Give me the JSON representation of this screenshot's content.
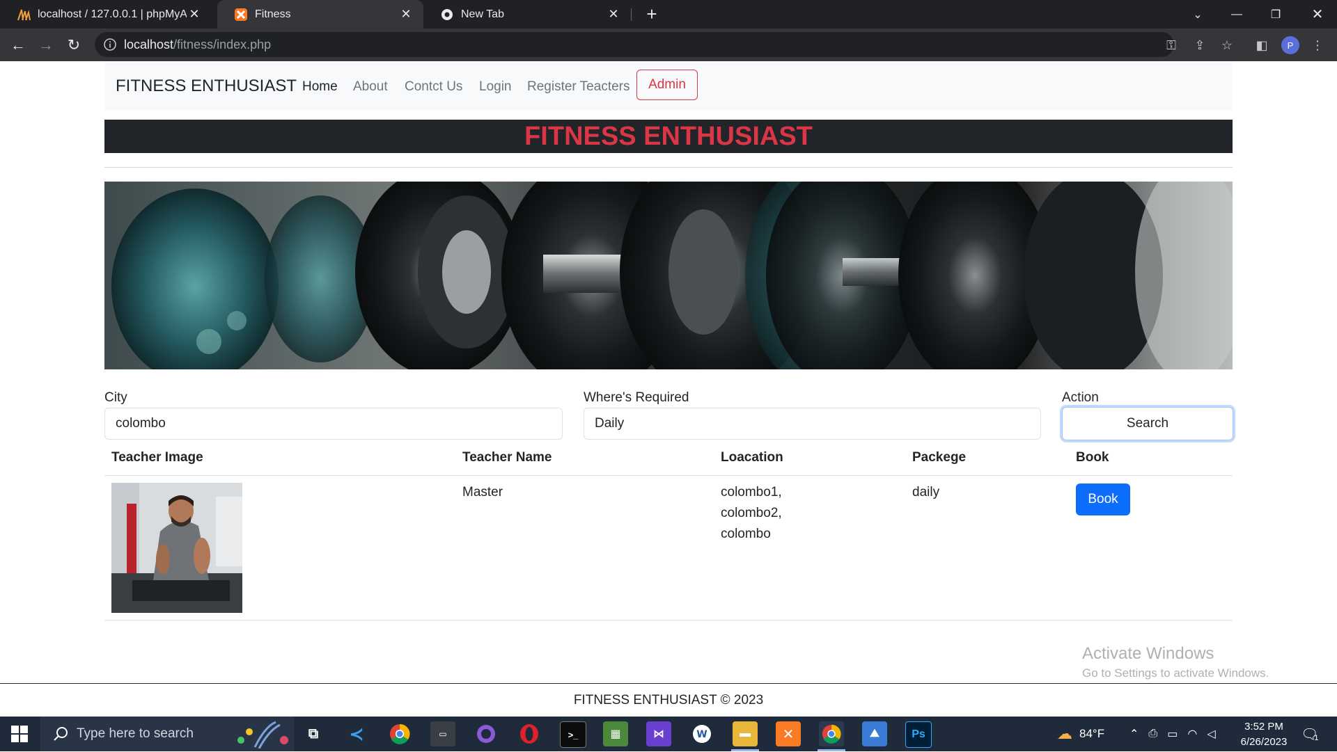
{
  "browser": {
    "tabs": [
      {
        "title": "localhost / 127.0.0.1 | phpMyAdmin",
        "icon": "phpmyadmin-icon",
        "active": false
      },
      {
        "title": "Fitness",
        "icon": "xampp-icon",
        "active": true
      },
      {
        "title": "New Tab",
        "icon": "chrome-icon",
        "active": false
      }
    ],
    "url_host": "localhost",
    "url_path": "/fitness/index.php",
    "profile_initial": "P"
  },
  "navbar": {
    "brand": "FITNESS ENTHUSIAST",
    "links": [
      "Home",
      "About",
      "Contct Us",
      "Login",
      "Register Teacters"
    ],
    "admin": "Admin"
  },
  "banner": {
    "title": "FITNESS ENTHUSIAST"
  },
  "search": {
    "city_label": "City",
    "city_value": "colombo",
    "required_label": "Where's Required",
    "required_value": "Daily",
    "action_label": "Action",
    "search_button": "Search"
  },
  "table": {
    "headers": [
      "Teacher Image",
      "Teacher Name",
      "Loacation",
      "Packege",
      "Book"
    ],
    "rows": [
      {
        "name": "Master",
        "location": [
          "colombo1,",
          "colombo2,",
          "colombo"
        ],
        "package": "daily",
        "book": "Book"
      }
    ]
  },
  "watermark": {
    "line1": "Activate Windows",
    "line2": "Go to Settings to activate Windows."
  },
  "footer": {
    "text": "FITNESS ENTHUSIAST © 2023"
  },
  "taskbar": {
    "search_placeholder": "Type here to search",
    "weather": "84°F",
    "time": "3:52 PM",
    "date": "6/26/2023",
    "notification_count": "1"
  },
  "colors": {
    "accent_red": "#dc3545",
    "primary_blue": "#0d6efd",
    "dark": "#212529"
  }
}
